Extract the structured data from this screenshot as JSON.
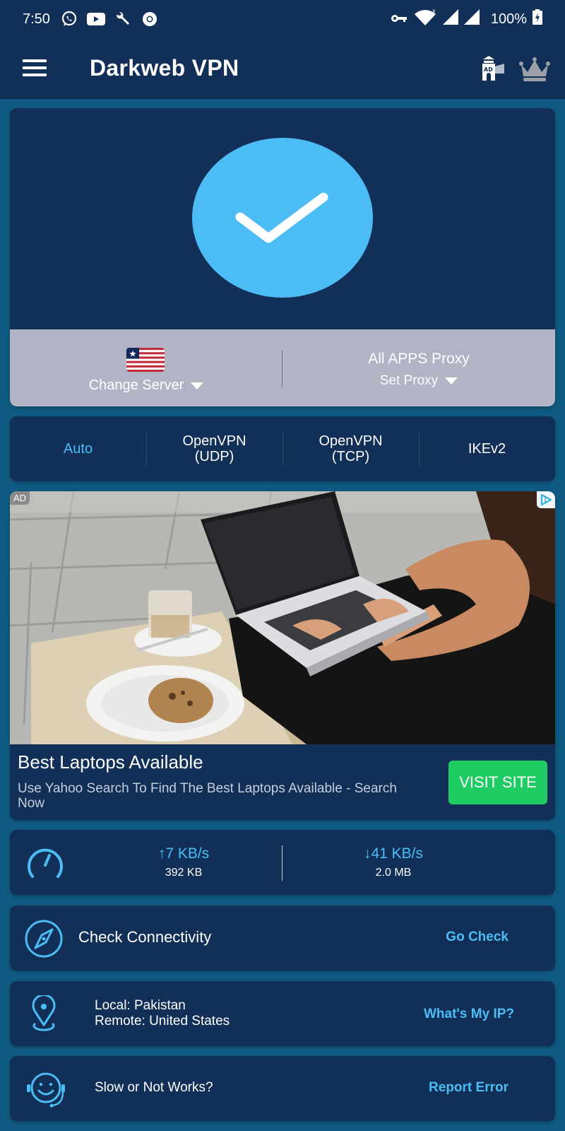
{
  "status_bar": {
    "time": "7:50",
    "left_icons": [
      "whatsapp-icon",
      "youtube-icon",
      "wrench-icon",
      "chrome-icon"
    ],
    "right_icons": [
      "vpn-key-icon",
      "wifi-icon",
      "signal-icon",
      "signal-icon"
    ],
    "battery": "100%"
  },
  "app_bar": {
    "title": "Darkweb VPN",
    "menu_icon": "hamburger-icon",
    "adblock_icon": "ad-block-tower-icon",
    "adblock_badge": "AD",
    "premium_icon": "crown-icon"
  },
  "connection": {
    "state": "connected",
    "state_icon": "checkmark-icon",
    "server_flag": "liberia-flag",
    "change_server_label": "Change Server",
    "proxy_title": "All APPS Proxy",
    "set_proxy_label": "Set Proxy"
  },
  "protocols": [
    {
      "line1": "Auto",
      "line2": "",
      "active": true
    },
    {
      "line1": "OpenVPN",
      "line2": "(UDP)",
      "active": false
    },
    {
      "line1": "OpenVPN",
      "line2": "(TCP)",
      "active": false
    },
    {
      "line1": "IKEv2",
      "line2": "",
      "active": false
    }
  ],
  "ad": {
    "badge": "AD",
    "title": "Best Laptops Available",
    "description": "Use Yahoo Search To Find The Best Laptops Available - Search Now",
    "cta": "VISIT SITE"
  },
  "speed": {
    "upload_rate": "↑7 KB/s",
    "upload_total": "392 KB",
    "download_rate": "↓41 KB/s",
    "download_total": "2.0 MB"
  },
  "connectivity": {
    "label": "Check Connectivity",
    "action": "Go Check"
  },
  "location": {
    "local": "Local: Pakistan",
    "remote": "Remote: United States",
    "action": "What's My IP?"
  },
  "report": {
    "label": "Slow or Not Works?",
    "action": "Report Error"
  },
  "colors": {
    "primary_bg": "#112f57",
    "page_bg": "#0f5a82",
    "accent": "#4bbdf4",
    "cta_green": "#1ecc63",
    "panel_gray": "#b2b4c6"
  }
}
